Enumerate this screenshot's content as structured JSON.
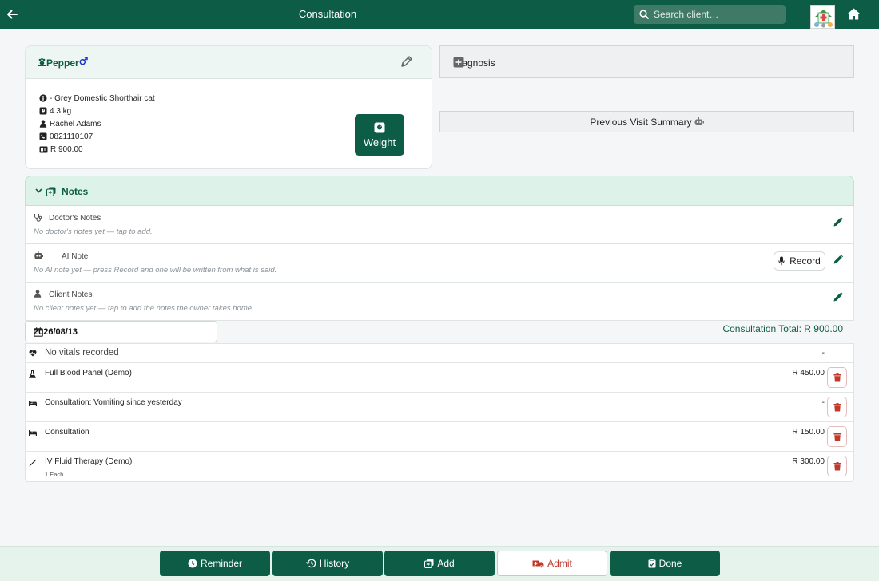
{
  "header": {
    "title": "Consultation",
    "search_placeholder": "Search client…"
  },
  "patient": {
    "name": "Pepper",
    "breed": "- Grey Domestic Shorthair cat",
    "weight": "4.3 kg",
    "owner": "Rachel Adams",
    "phone": "0821110107",
    "balance": "R 900.00",
    "weight_button": "Weight"
  },
  "diagnosis": {
    "label": "Diagnosis"
  },
  "previous_visit": {
    "label": "Previous Visit Summary"
  },
  "notes": {
    "title": "Notes",
    "doctor": {
      "title": "Doctor's Notes",
      "text": "No doctor's notes yet — tap to add."
    },
    "ai": {
      "title": "AI Note",
      "text": "No AI note yet — press Record and one will be written from what is said.",
      "record_label": "Record"
    },
    "client": {
      "title": "Client Notes",
      "text": "No client notes yet — tap to add the notes the owner takes home."
    }
  },
  "consultation": {
    "date": "2026/08/13",
    "total": "Consultation Total: R 900.00"
  },
  "items": [
    {
      "name": "No vitals recorded",
      "price": "-",
      "icon": "heart-icon"
    },
    {
      "name": "Full Blood Panel (Demo)",
      "price": "R 450.00",
      "icon": "flask-icon"
    },
    {
      "name": "Consultation: Vomiting since yesterday",
      "price": "-",
      "icon": "bed-icon"
    },
    {
      "name": "Consultation",
      "price": "R 150.00",
      "icon": "bed-icon"
    },
    {
      "name": "IV Fluid Therapy (Demo)",
      "sub": "1 Each",
      "price": "R 300.00",
      "icon": "syringe-icon"
    }
  ],
  "bottom": {
    "reminder": "Reminder",
    "history": "History",
    "add": "Add",
    "admit": "Admit",
    "done": "Done"
  },
  "colors": {
    "brand": "#0d5c45",
    "danger": "#c0392b",
    "notes_bg": "#ddf2e8"
  }
}
